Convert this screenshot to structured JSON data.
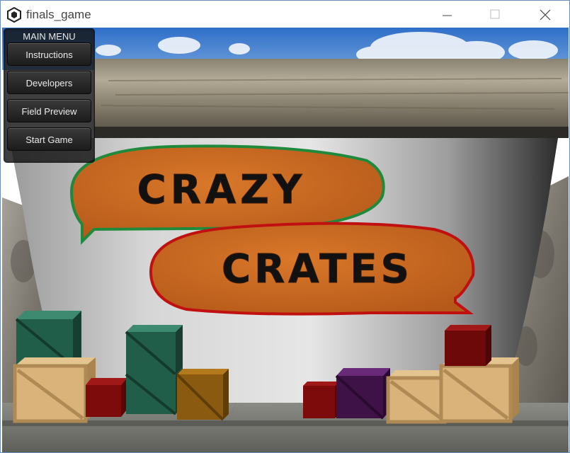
{
  "window": {
    "title": "finals_game"
  },
  "main_menu": {
    "title": "MAIN MENU",
    "buttons": [
      "Instructions",
      "Developers",
      "Field Preview",
      "Start Game"
    ]
  },
  "sign": {
    "line1": "CRAZY",
    "line2": "CRATES"
  },
  "colors": {
    "bubble_fill": "#c8691e",
    "crazy_outline": "#1f8a3c",
    "crates_outline": "#c01010",
    "letters": "#111111"
  }
}
